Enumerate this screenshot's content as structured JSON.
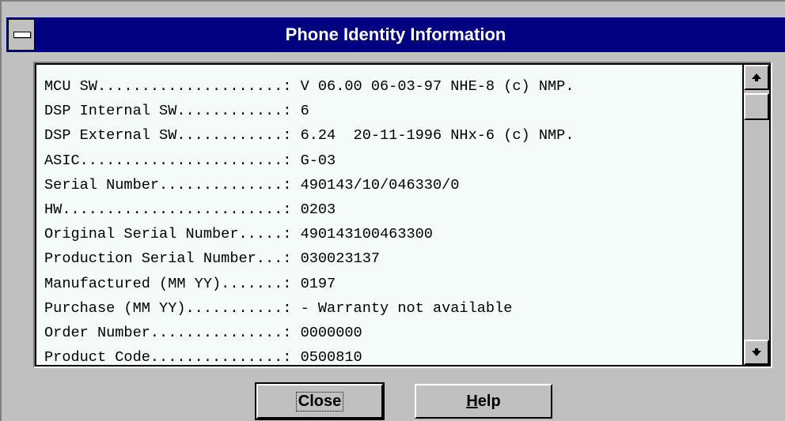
{
  "window": {
    "title": "Phone Identity Information"
  },
  "info_rows": [
    "MCU SW.....................: V 06.00 06-03-97 NHE-8 (c) NMP.",
    "DSP Internal SW............: 6",
    "DSP External SW............: 6.24  20-11-1996 NHx-6 (c) NMP.",
    "ASIC.......................: G-03",
    "Serial Number..............: 490143/10/046330/0",
    "HW.........................: 0203",
    "Original Serial Number.....: 490143100463300",
    "Production Serial Number...: 030023137",
    "Manufactured (MM YY).......: 0197",
    "Purchase (MM YY)...........: - Warranty not available",
    "Order Number...............: 0000000",
    "Product Code...............: 0500810"
  ],
  "buttons": {
    "close_label": "Close",
    "help_label_mnemonic": "H",
    "help_label_rest": "elp"
  },
  "icons": {
    "system_menu": "system-menu-icon",
    "scroll_up": "arrow-up-icon",
    "scroll_down": "arrow-down-icon"
  }
}
